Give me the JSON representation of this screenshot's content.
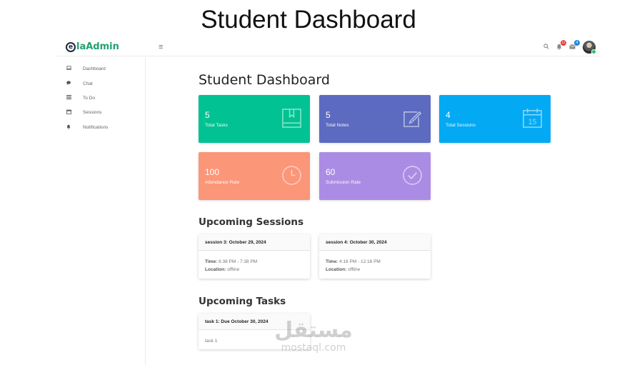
{
  "banner": {
    "title": "Student Dashboard"
  },
  "app": {
    "logo_mark": "e",
    "logo_text": "laAdmin",
    "menu_icon": "hamburger-icon",
    "header_icons": [
      "search-icon",
      "bell-icon",
      "mail-icon"
    ],
    "notification_badge": "12",
    "mail_badge": "4"
  },
  "sidebar": {
    "items": [
      {
        "label": "Dashboard",
        "icon": "laptop-icon"
      },
      {
        "label": "Chat",
        "icon": "chat-icon"
      },
      {
        "label": "To Do",
        "icon": "list-icon"
      },
      {
        "label": "Sessions",
        "icon": "calendar-icon"
      },
      {
        "label": "Notifications",
        "icon": "bell-icon"
      }
    ]
  },
  "main": {
    "title": "Student Dashboard",
    "stats": [
      {
        "value": "5",
        "label": "Total Tasks",
        "color": "#00c292",
        "icon": "book-icon"
      },
      {
        "value": "5",
        "label": "Total Notes",
        "color": "#5c6bc0",
        "icon": "note-edit-icon"
      },
      {
        "value": "4",
        "label": "Total Sessions",
        "color": "#03a9f3",
        "icon": "calendar-icon"
      },
      {
        "value": "100",
        "label": "Attendance Rate",
        "color": "#fb9678",
        "icon": "clock-icon"
      },
      {
        "value": "60",
        "label": "Submission Rate",
        "color": "#ab8ce4",
        "icon": "check-circle-icon"
      }
    ],
    "sessions_title": "Upcoming Sessions",
    "sessions": [
      {
        "title": "session 3: October 29, 2024",
        "time_label": "Time:",
        "time": "6:38 PM - 7:38 PM",
        "location_label": "Location:",
        "location": "offline"
      },
      {
        "title": "session 4: October 30, 2024",
        "time_label": "Time:",
        "time": "4:16 PM - 12:16 PM",
        "location_label": "Location:",
        "location": "offline"
      }
    ],
    "tasks_title": "Upcoming Tasks",
    "tasks": [
      {
        "title": "task 1: Due October 30, 2024",
        "body": "task 1"
      }
    ]
  },
  "watermark": {
    "arabic": "مستقل",
    "latin": "mostaql.com"
  }
}
